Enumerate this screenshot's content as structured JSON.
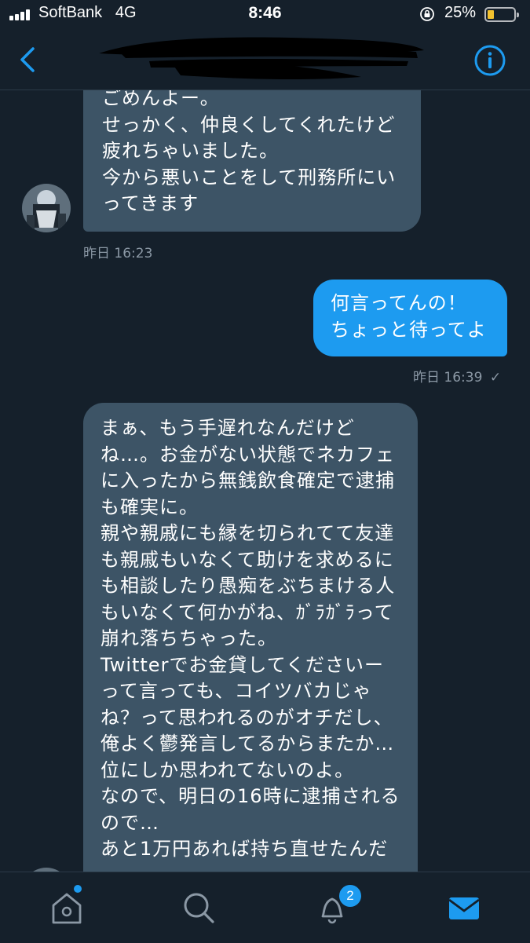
{
  "status_bar": {
    "carrier": "SoftBank",
    "network": "4G",
    "time": "8:46",
    "battery_percent": "25%",
    "battery_level": 0.25
  },
  "header": {
    "back_icon": "chevron-left-icon",
    "info_icon": "info-icon",
    "title_redacted": true
  },
  "messages": [
    {
      "direction": "incoming",
      "lines": [
        "ごめんよー。",
        "せっかく、仲良くしてくれたけど",
        "疲れちゃいました。",
        "今から悪いことをして刑務所にい",
        "ってきます"
      ],
      "timestamp": "昨日 16:23"
    },
    {
      "direction": "outgoing",
      "lines": [
        "何言ってんの！",
        "ちょっと待ってよ"
      ],
      "timestamp": "昨日 16:39",
      "status_icon": "checkmark-icon"
    },
    {
      "direction": "incoming",
      "lines": [
        "まぁ、もう手遅れなんだけど",
        "ね…。お金がない状態でネカフェ",
        "に入ったから無銭飲食確定で逮捕",
        "も確実に。",
        "親や親戚にも縁を切られてて友達",
        "も親戚もいなくて助けを求めるに",
        "も相談したり愚痴をぶちまける人",
        "もいなくて何かがね、ｶﾞﾗｶﾞﾗって",
        "崩れ落ちちゃった。",
        "Twitterでお金貸してくださいー",
        "って言っても、コイツバカじゃ",
        "ね？って思われるのがオチだし、",
        "俺よく鬱発言してるからまたか…",
        "位にしか思われてないのよ。",
        "なので、明日の16時に逮捕される",
        "ので…",
        "あと1万円あれば持ち直せたんだ"
      ]
    }
  ],
  "tab_bar": {
    "tabs": [
      {
        "name": "home",
        "icon": "home-icon",
        "has_dot": true
      },
      {
        "name": "search",
        "icon": "search-icon"
      },
      {
        "name": "notifications",
        "icon": "bell-icon",
        "badge": "2"
      },
      {
        "name": "messages",
        "icon": "mail-icon",
        "active": true
      }
    ],
    "accent": "#1d9bf0"
  },
  "colors": {
    "background": "#15202b",
    "incoming_bubble": "#3d5466",
    "outgoing_bubble": "#1d9bf0",
    "timestamp": "#8b98a5",
    "battery_fill": "#f3c22f"
  }
}
